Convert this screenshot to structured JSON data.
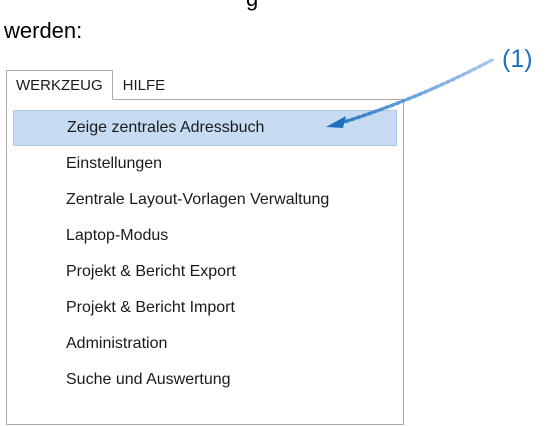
{
  "document": {
    "top_fragment": "g",
    "line_text": "werden:",
    "callout_label": "(1)"
  },
  "menubar": {
    "items": [
      {
        "label": "WERKZEUG",
        "active": true
      },
      {
        "label": "HILFE",
        "active": false
      }
    ]
  },
  "dropdown": {
    "items": [
      {
        "label": "Zeige zentrales Adressbuch",
        "highlighted": true
      },
      {
        "label": "Einstellungen"
      },
      {
        "label": "Zentrale Layout-Vorlagen Verwaltung"
      },
      {
        "label": "Laptop-Modus"
      },
      {
        "label": "Projekt & Bericht Export"
      },
      {
        "label": "Projekt & Bericht Import"
      },
      {
        "label": "Administration"
      },
      {
        "label": "Suche und Auswertung"
      }
    ]
  },
  "colors": {
    "callout": "#1f6fc1",
    "highlight_background": "#c7dcf3",
    "menu_border": "#a9a9a9"
  }
}
